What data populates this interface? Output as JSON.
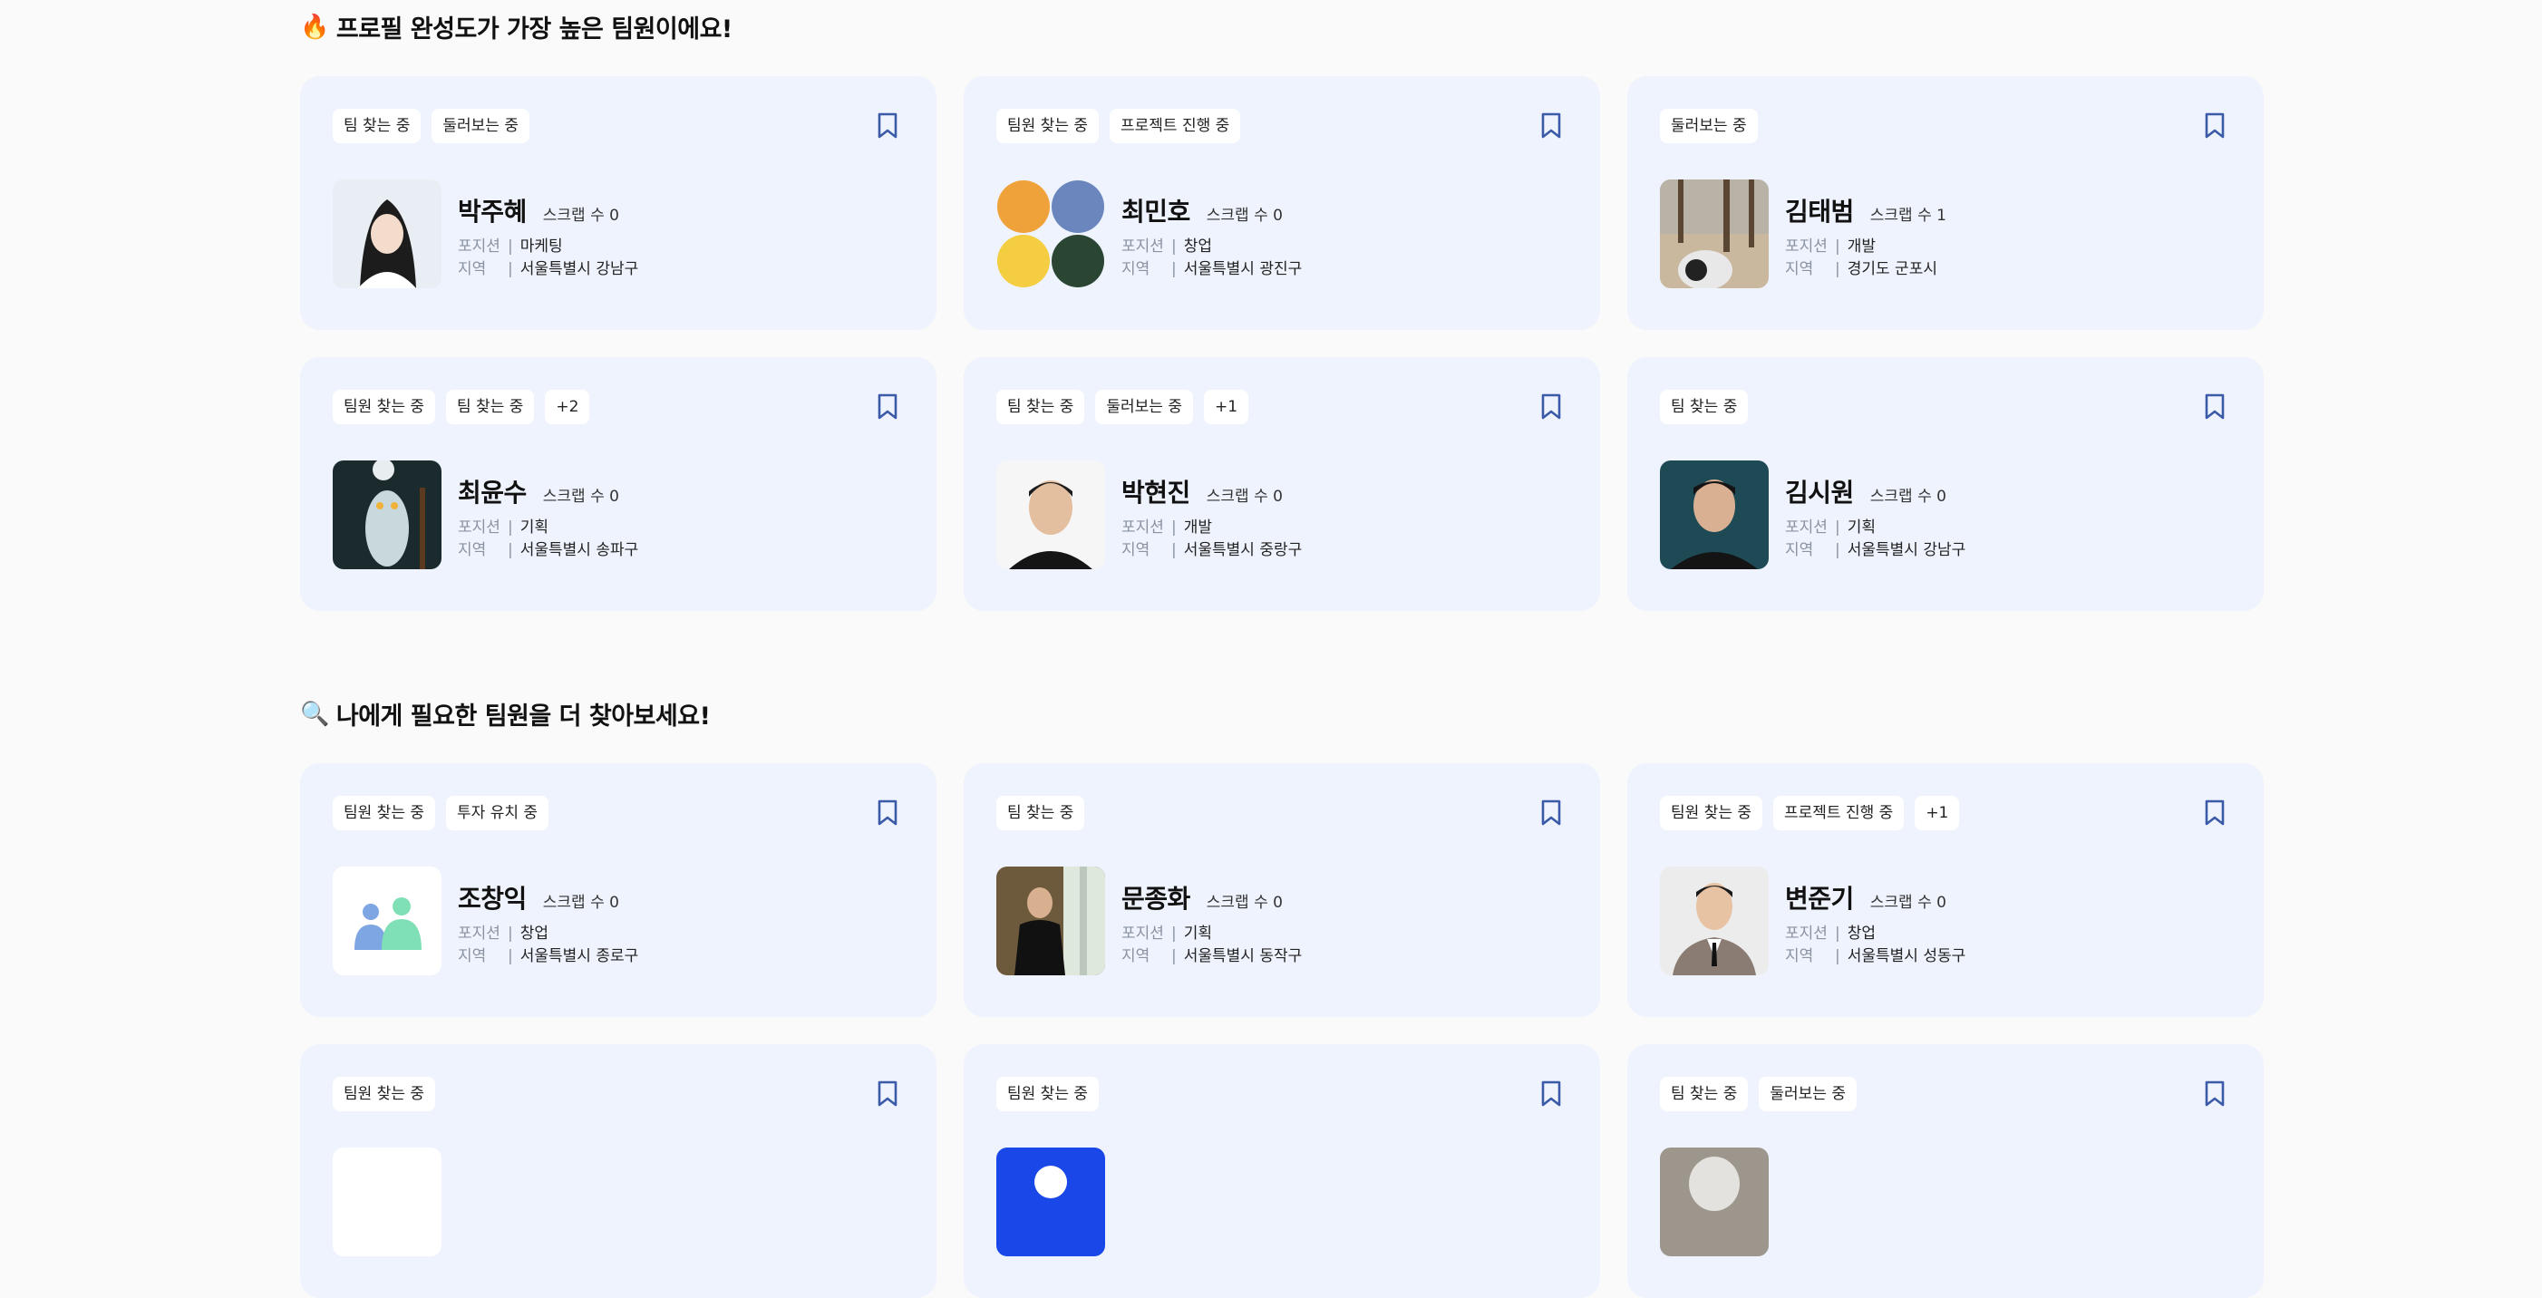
{
  "sections": [
    {
      "emoji": "🔥",
      "icon": "fire-icon",
      "title": "프로필 완성도가 가장 높은 팀원이에요!",
      "cards": [
        {
          "tags": [
            "팀 찾는 중",
            "둘러보는 중"
          ],
          "name": "박주혜",
          "scrap": "스크랩 수 0",
          "position": "마케팅",
          "region": "서울특별시 강남구",
          "avatar": "portrait-woman"
        },
        {
          "tags": [
            "팀원 찾는 중",
            "프로젝트 진행 중"
          ],
          "name": "최민호",
          "scrap": "스크랩 수 0",
          "position": "창업",
          "region": "서울특별시 광진구",
          "avatar": "four-circles"
        },
        {
          "tags": [
            "둘러보는 중"
          ],
          "name": "김태범",
          "scrap": "스크랩 수 1",
          "position": "개발",
          "region": "경기도 군포시",
          "avatar": "park-photo"
        },
        {
          "tags": [
            "팀원 찾는 중",
            "팀 찾는 중",
            "+2"
          ],
          "name": "최윤수",
          "scrap": "스크랩 수 0",
          "position": "기획",
          "region": "서울특별시 송파구",
          "avatar": "owl-photo"
        },
        {
          "tags": [
            "팀 찾는 중",
            "둘러보는 중",
            "+1"
          ],
          "name": "박현진",
          "scrap": "스크랩 수 0",
          "position": "개발",
          "region": "서울특별시 중랑구",
          "avatar": "portrait-man"
        },
        {
          "tags": [
            "팀 찾는 중"
          ],
          "name": "김시원",
          "scrap": "스크랩 수 0",
          "position": "기획",
          "region": "서울특별시 강남구",
          "avatar": "portrait-man-dark"
        }
      ]
    },
    {
      "emoji": "🔍",
      "icon": "magnifier-icon",
      "title": "나에게 필요한 팀원을 더 찾아보세요!",
      "cards": [
        {
          "tags": [
            "팀원 찾는 중",
            "투자 유치 중"
          ],
          "name": "조창익",
          "scrap": "스크랩 수 0",
          "position": "창업",
          "region": "서울특별시 종로구",
          "avatar": "default-people"
        },
        {
          "tags": [
            "팀 찾는 중"
          ],
          "name": "문종화",
          "scrap": "스크랩 수 0",
          "position": "기획",
          "region": "서울특별시 동작구",
          "avatar": "portrait-window"
        },
        {
          "tags": [
            "팀원 찾는 중",
            "프로젝트 진행 중",
            "+1"
          ],
          "name": "변준기",
          "scrap": "스크랩 수 0",
          "position": "창업",
          "region": "서울특별시 성동구",
          "avatar": "portrait-suit"
        },
        {
          "tags": [
            "팀원 찾는 중"
          ],
          "name": "",
          "scrap": "",
          "position": "",
          "region": "",
          "avatar": "white"
        },
        {
          "tags": [
            "팀원 찾는 중"
          ],
          "name": "",
          "scrap": "",
          "position": "",
          "region": "",
          "avatar": "blue"
        },
        {
          "tags": [
            "팀 찾는 중",
            "둘러보는 중"
          ],
          "name": "",
          "scrap": "",
          "position": "",
          "region": "",
          "avatar": "gray-photo"
        }
      ]
    }
  ],
  "labels": {
    "position_key": "포지션",
    "region_key": "지역"
  },
  "colors": {
    "card_bg": "#eef3fd",
    "bookmark": "#3b5ba8",
    "page_bg": "#fafafa"
  }
}
